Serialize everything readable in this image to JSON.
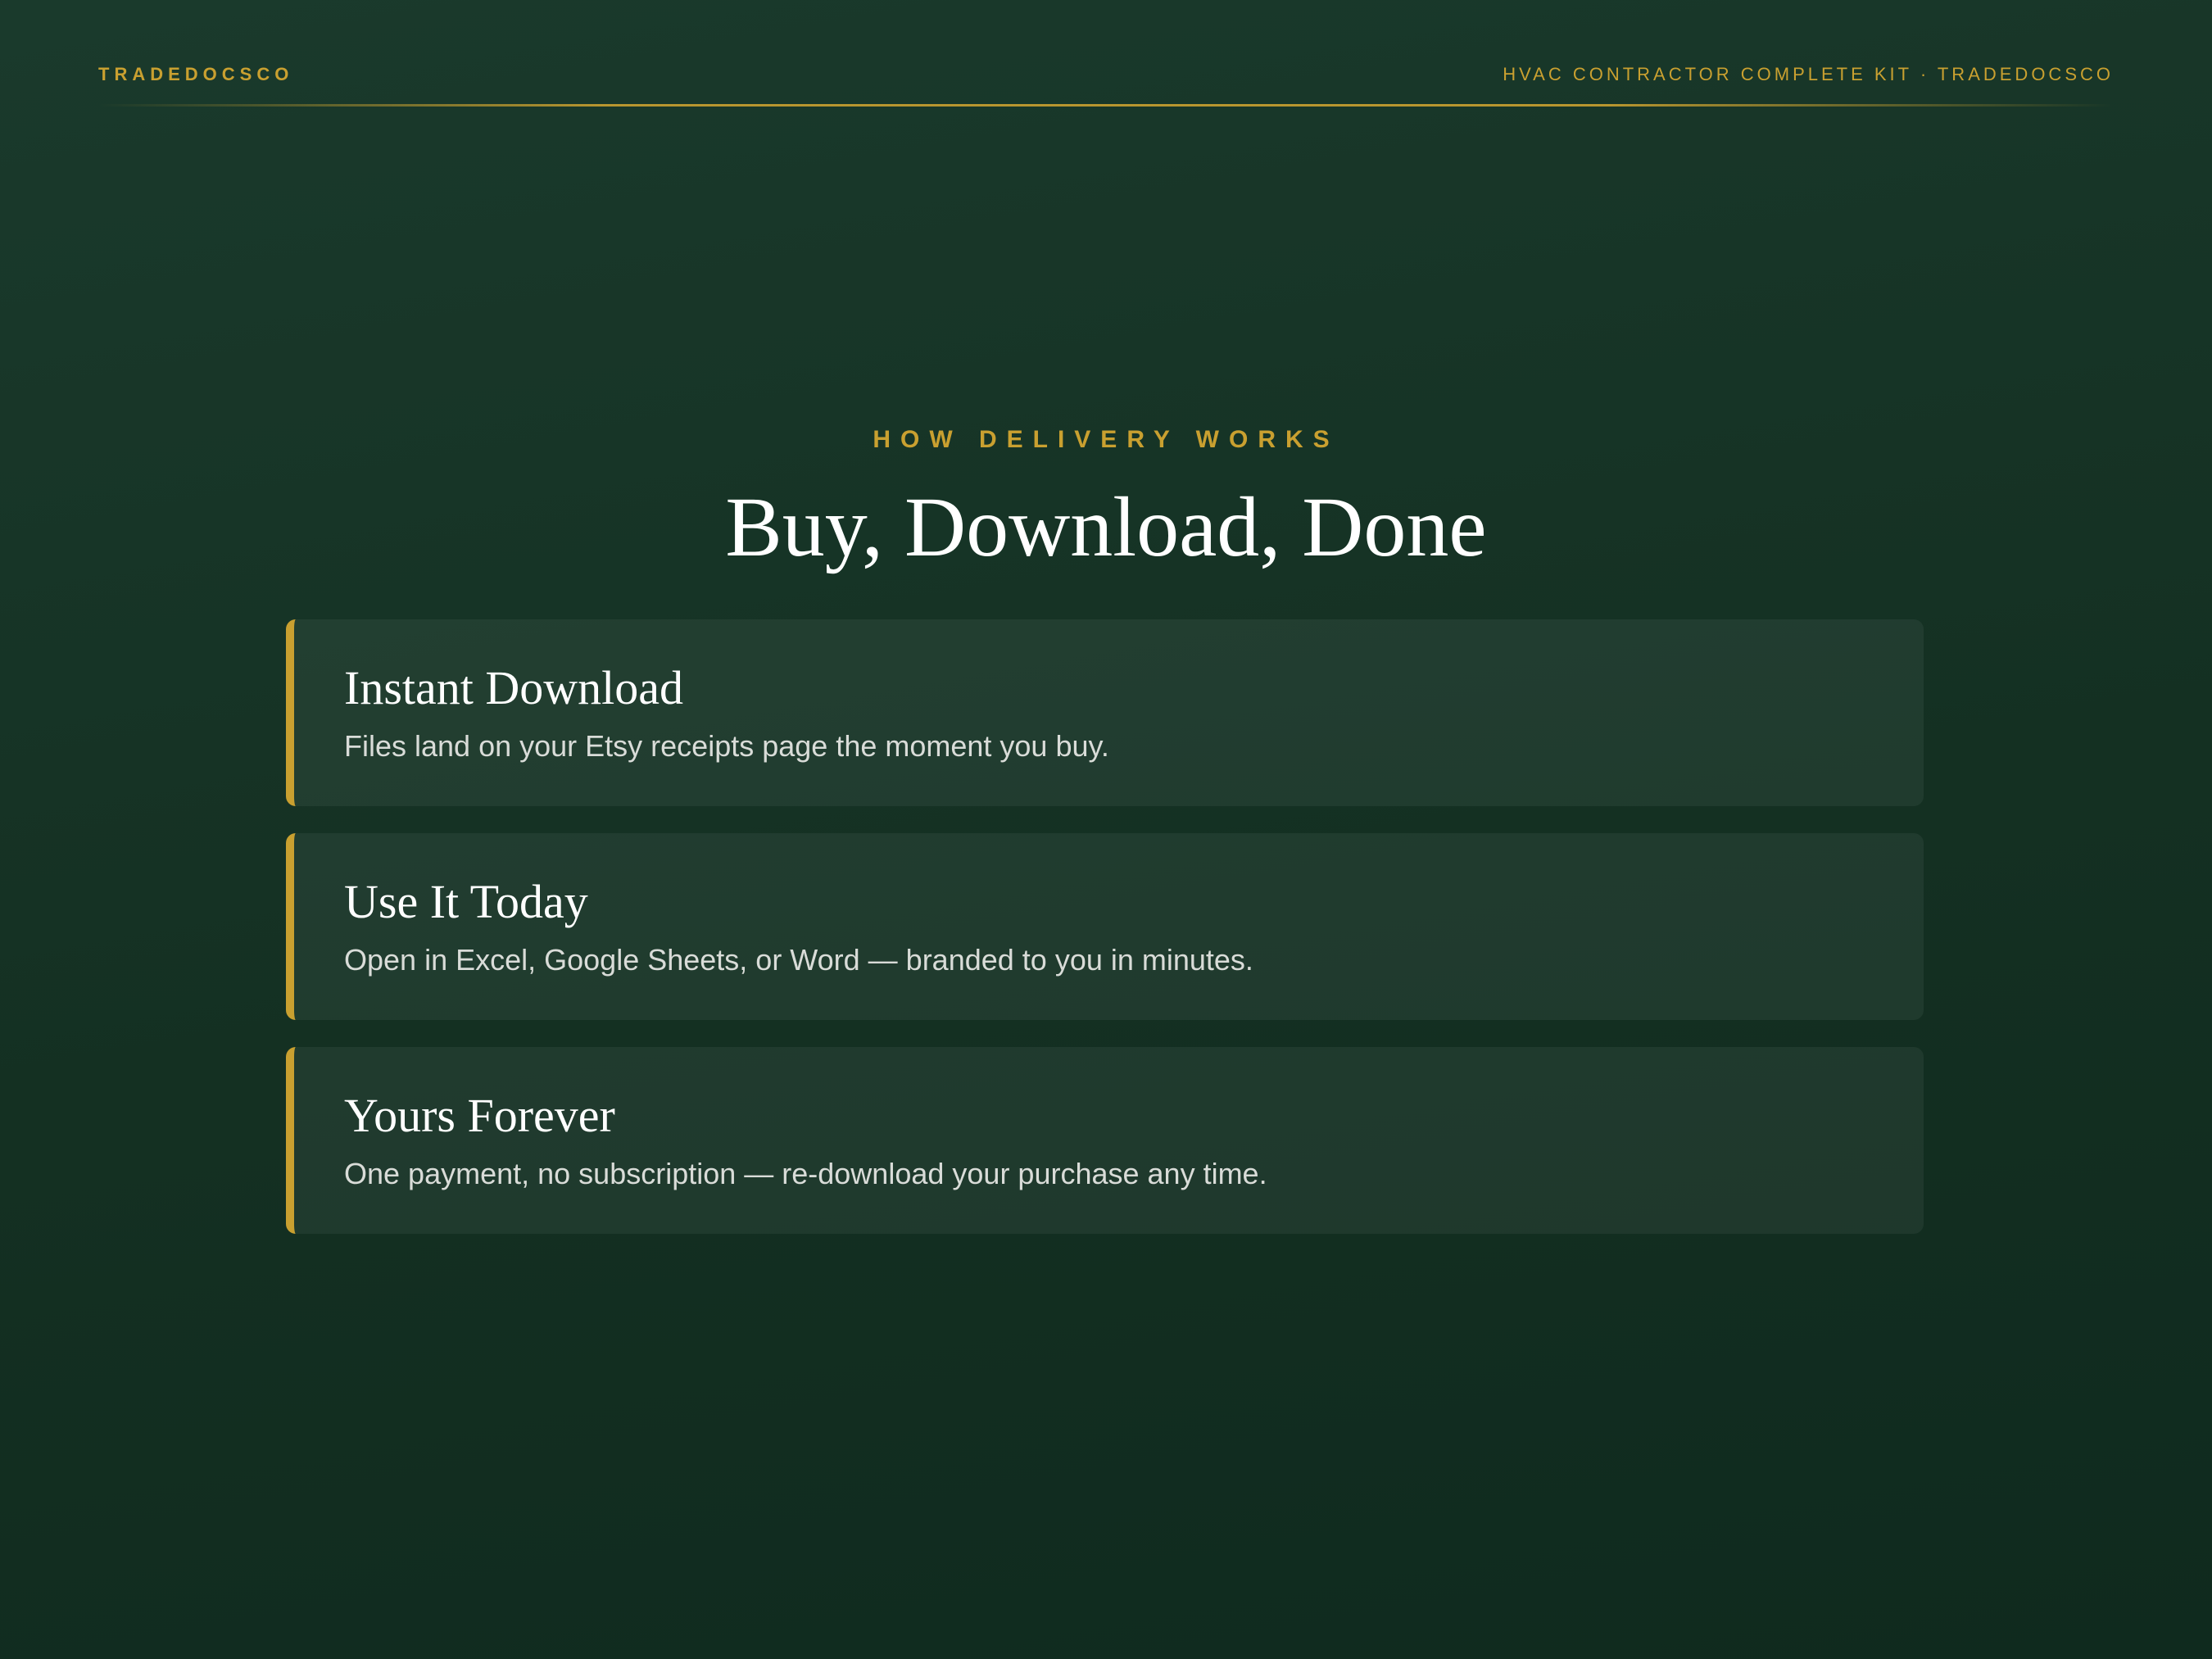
{
  "header": {
    "brand": "TRADEDOCSCO",
    "right_text": "HVAC CONTRACTOR COMPLETE KIT · TRADEDOCSCO"
  },
  "hero": {
    "eyebrow": "HOW DELIVERY WORKS",
    "title": "Buy, Download, Done"
  },
  "cards": [
    {
      "title": "Instant Download",
      "text": "Files land on your Etsy receipts page the moment you buy."
    },
    {
      "title": "Use It Today",
      "text": "Open in Excel, Google Sheets, or Word — branded to you in minutes."
    },
    {
      "title": "Yours Forever",
      "text": "One payment, no subscription — re-download your purchase any time."
    }
  ],
  "colors": {
    "background": "#143022",
    "accent_gold": "#c9a030",
    "card_text": "#d9dcd8"
  }
}
